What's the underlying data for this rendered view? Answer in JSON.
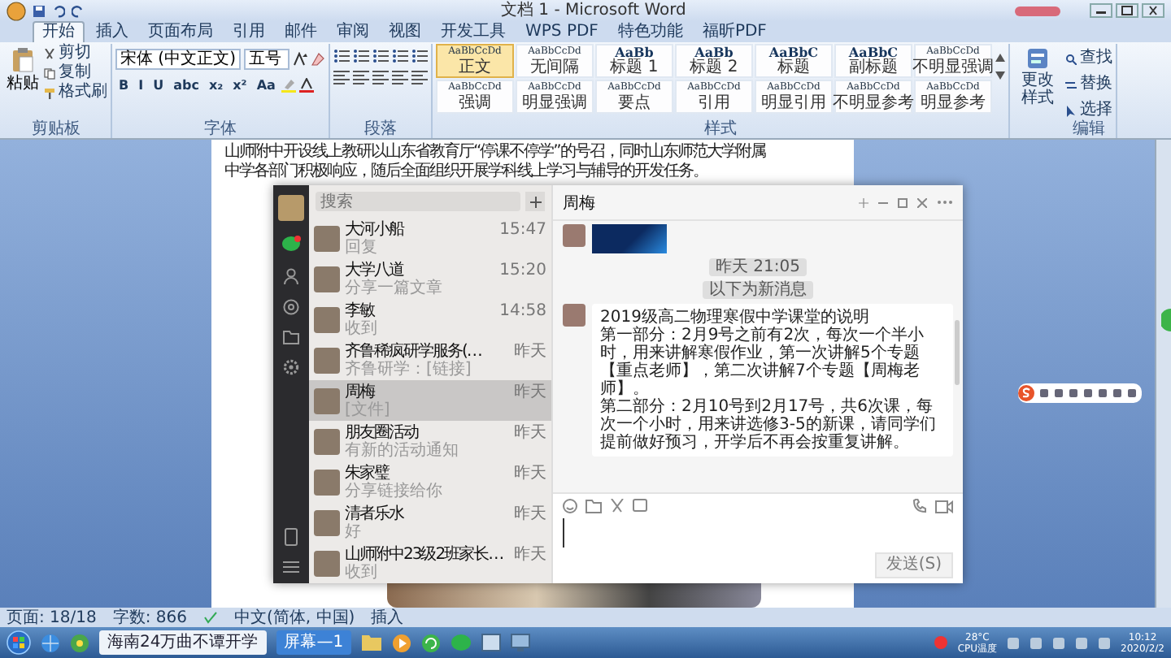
{
  "window": {
    "title": "文档 1 - Microsoft Word"
  },
  "ribbon_tabs": [
    {
      "label": "开始",
      "selected": true
    },
    {
      "label": "插入",
      "selected": false
    },
    {
      "label": "页面布局",
      "selected": false
    },
    {
      "label": "引用",
      "selected": false
    },
    {
      "label": "邮件",
      "selected": false
    },
    {
      "label": "审阅",
      "selected": false
    },
    {
      "label": "视图",
      "selected": false
    },
    {
      "label": "开发工具",
      "selected": false
    },
    {
      "label": "WPS PDF",
      "selected": false
    },
    {
      "label": "特色功能",
      "selected": false
    },
    {
      "label": "福昕PDF",
      "selected": false
    }
  ],
  "ribbon": {
    "clipboard": {
      "paste": "粘贴",
      "cut": "剪切",
      "copy": "复制",
      "format_painter": "格式刷",
      "group": "剪贴板"
    },
    "font": {
      "family": "宋体 (中文正文)",
      "size": "五号",
      "format_buttons": [
        "B",
        "I",
        "U",
        "abc",
        "x₂",
        "x²",
        "Aa"
      ],
      "group": "字体"
    },
    "paragraph": {
      "group": "段落"
    },
    "styles": {
      "group": "样式",
      "items": [
        {
          "sample": "AaBbCcDd",
          "label": "正文",
          "kind": "body",
          "selected": true
        },
        {
          "sample": "AaBbCcDd",
          "label": "无间隔",
          "kind": "body",
          "selected": false
        },
        {
          "sample": "AaBb",
          "label": "标题 1",
          "kind": "heading",
          "selected": false
        },
        {
          "sample": "AaBb",
          "label": "标题 2",
          "kind": "heading",
          "selected": false
        },
        {
          "sample": "AaBbC",
          "label": "标题",
          "kind": "heading",
          "selected": false
        },
        {
          "sample": "AaBbC",
          "label": "副标题",
          "kind": "heading",
          "selected": false
        },
        {
          "sample": "AaBbCcDd",
          "label": "不明显强调",
          "kind": "body",
          "selected": false
        },
        {
          "sample": "AaBbCcDd",
          "label": "强调",
          "kind": "body",
          "selected": false
        },
        {
          "sample": "AaBbCcDd",
          "label": "明显强调",
          "kind": "body",
          "selected": false
        },
        {
          "sample": "AaBbCcDd",
          "label": "要点",
          "kind": "body",
          "selected": false
        },
        {
          "sample": "AaBbCcDd",
          "label": "引用",
          "kind": "body",
          "selected": false
        },
        {
          "sample": "AaBbCcDd",
          "label": "明显引用",
          "kind": "body",
          "selected": false
        },
        {
          "sample": "AaBbCcDd",
          "label": "不明显参考",
          "kind": "body",
          "selected": false
        },
        {
          "sample": "AaBbCcDd",
          "label": "明显参考",
          "kind": "body",
          "selected": false
        }
      ]
    },
    "change_styles": "更改样式",
    "editing": {
      "find": "查找",
      "replace": "替换",
      "select": "选择",
      "group": "编辑"
    }
  },
  "document": {
    "lines": [
      "山师附中开设线上教研以山东省教育厅“停课不停学”的号召，同时山东师范大学附属",
      "中学各部门积极响应，随后全面组织开展学科线上学习与辅导的开发任务。"
    ]
  },
  "wechat": {
    "search": {
      "placeholder": "搜索"
    },
    "chats": [
      {
        "name": "大河小船",
        "preview": "回复",
        "time": "15:47",
        "selected": false
      },
      {
        "name": "大学八道",
        "preview": "分享一篇文章",
        "time": "15:20",
        "selected": false
      },
      {
        "name": "李敏",
        "preview": "收到",
        "time": "14:58",
        "selected": false
      },
      {
        "name": "齐鲁稀疯研学服务(…",
        "preview": "齐鲁研学：[链接]",
        "time": "昨天",
        "selected": false
      },
      {
        "name": "周梅",
        "preview": "[文件]",
        "time": "昨天",
        "selected": true
      },
      {
        "name": "朋友圈活动",
        "preview": "有新的活动通知",
        "time": "昨天",
        "selected": false
      },
      {
        "name": "朱家璧",
        "preview": "分享链接给你",
        "time": "昨天",
        "selected": false
      },
      {
        "name": "清者乐水",
        "preview": "好",
        "time": "昨天",
        "selected": false
      },
      {
        "name": "山师附中23级2班家长…",
        "preview": "收到",
        "time": "昨天",
        "selected": false
      }
    ],
    "chat": {
      "title": "周梅",
      "timestamps": [
        "昨天 21:05",
        "以下为新消息"
      ],
      "message": [
        "2019级高二物理寒假中学课堂的说明",
        "第一部分：2月9号之前有2次，每次一个半小时，用来讲解寒假作业，第一次讲解5个专题【重点老师】，第二次讲解7个专题【周梅老师】。",
        "第二部分：2月10号到2月17号，共6次课，每次一个小时，用来讲选修3-5的新课，请同学们提前做好预习，开学后不再会按重复讲解。"
      ],
      "send": "发送(S)"
    }
  },
  "status_bar": {
    "page": "页面: 18/18",
    "words": "字数: 866",
    "language": "中文(简体, 中国)",
    "mode": "插入"
  },
  "taskbar": {
    "windows": [
      {
        "label": "海南24万曲不谭开学",
        "selected": false
      },
      {
        "label": "屏幕—1",
        "selected": true
      }
    ],
    "temperature": "28°C",
    "cpu": "CPU温度",
    "time": "10:12",
    "date": "2020/2/2"
  }
}
